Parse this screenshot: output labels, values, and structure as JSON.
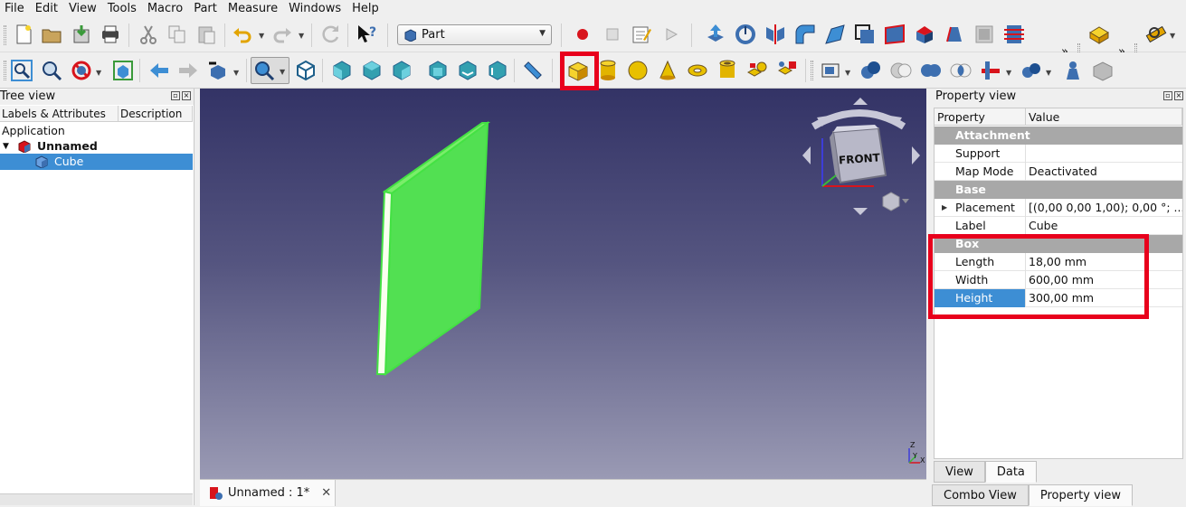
{
  "menu": [
    "File",
    "Edit",
    "View",
    "Tools",
    "Macro",
    "Part",
    "Measure",
    "Windows",
    "Help"
  ],
  "toolbar": {
    "workbench": "Part",
    "overflow": "»"
  },
  "tree_view": {
    "title": "Tree view",
    "columns": [
      "Labels & Attributes",
      "Description"
    ],
    "root_label": "Application",
    "document": "Unnamed",
    "object": "Cube"
  },
  "viewport": {
    "navcube_face": "FRONT",
    "axis_z": "Z",
    "axis_y": "Y",
    "axis_x": "X",
    "document_tab": "Unnamed : 1*"
  },
  "property_view": {
    "title": "Property view",
    "columns": [
      "Property",
      "Value"
    ],
    "groups": [
      {
        "name": "Attachment",
        "rows": [
          {
            "key": "Support",
            "value": ""
          },
          {
            "key": "Map Mode",
            "value": "Deactivated"
          }
        ]
      },
      {
        "name": "Base",
        "rows": [
          {
            "key": "Placement",
            "value": "[(0,00 0,00 1,00); 0,00 °; ..."
          },
          {
            "key": "Label",
            "value": "Cube"
          }
        ]
      },
      {
        "name": "Box",
        "rows": [
          {
            "key": "Length",
            "value": "18,00 mm"
          },
          {
            "key": "Width",
            "value": "600,00 mm"
          },
          {
            "key": "Height",
            "value": "300,00 mm"
          }
        ]
      }
    ],
    "tabs": [
      "View",
      "Data"
    ],
    "active_tab": "Data"
  },
  "panel_tabs": [
    "Combo View",
    "Property view"
  ],
  "colors": {
    "highlight": "#e8001c",
    "selection": "#3d8ed4",
    "box_face": "#52e052",
    "property_group": "#a8a8a8"
  }
}
